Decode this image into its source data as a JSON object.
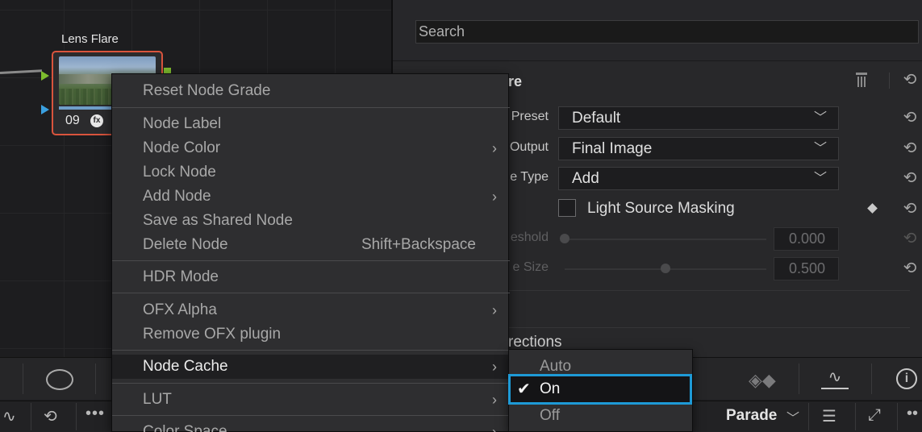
{
  "node": {
    "title": "Lens Flare",
    "number": "09",
    "fx_badge": "fx"
  },
  "search": {
    "placeholder": "Search"
  },
  "fx_panel": {
    "title": "re",
    "params": {
      "preset_label": "Preset",
      "preset_value": "Default",
      "output_label": "Output",
      "output_value": "Final Image",
      "type_label": "e Type",
      "type_value": "Add",
      "masking_label": "Light Source Masking",
      "threshold_label": "eshold",
      "threshold_value": "0.000",
      "size_label": "e Size",
      "size_value": "0.500",
      "size_slider_fraction": 0.5
    },
    "section_label": "rections"
  },
  "context_menu": {
    "items": [
      {
        "label": "Reset Node Grade"
      },
      {
        "label": "Node Label"
      },
      {
        "label": "Node Color"
      },
      {
        "label": "Lock Node"
      },
      {
        "label": "Add Node"
      },
      {
        "label": "Save as Shared Node"
      },
      {
        "label": "Delete Node",
        "shortcut": "Shift+Backspace"
      },
      {
        "label": "HDR Mode"
      },
      {
        "label": "OFX Alpha"
      },
      {
        "label": "Remove OFX plugin"
      },
      {
        "label": "Node Cache"
      },
      {
        "label": "LUT"
      },
      {
        "label": "Color Space"
      }
    ]
  },
  "node_cache_submenu": {
    "items": [
      {
        "label": "Auto"
      },
      {
        "label": "On",
        "checked": true
      },
      {
        "label": "Off"
      }
    ]
  },
  "scopes": {
    "mode_label": "Parade"
  },
  "icons": {
    "reset": "reset-icon",
    "trash": "trash-icon",
    "chevron": "chevron-down-icon",
    "submenu_arrow": "chevron-right-icon",
    "info": "info-icon"
  },
  "colors": {
    "accent": "#1e9ad6",
    "node_border": "#d9543d",
    "input_green": "#7dbb2e",
    "input_blue": "#3aa0e0"
  }
}
